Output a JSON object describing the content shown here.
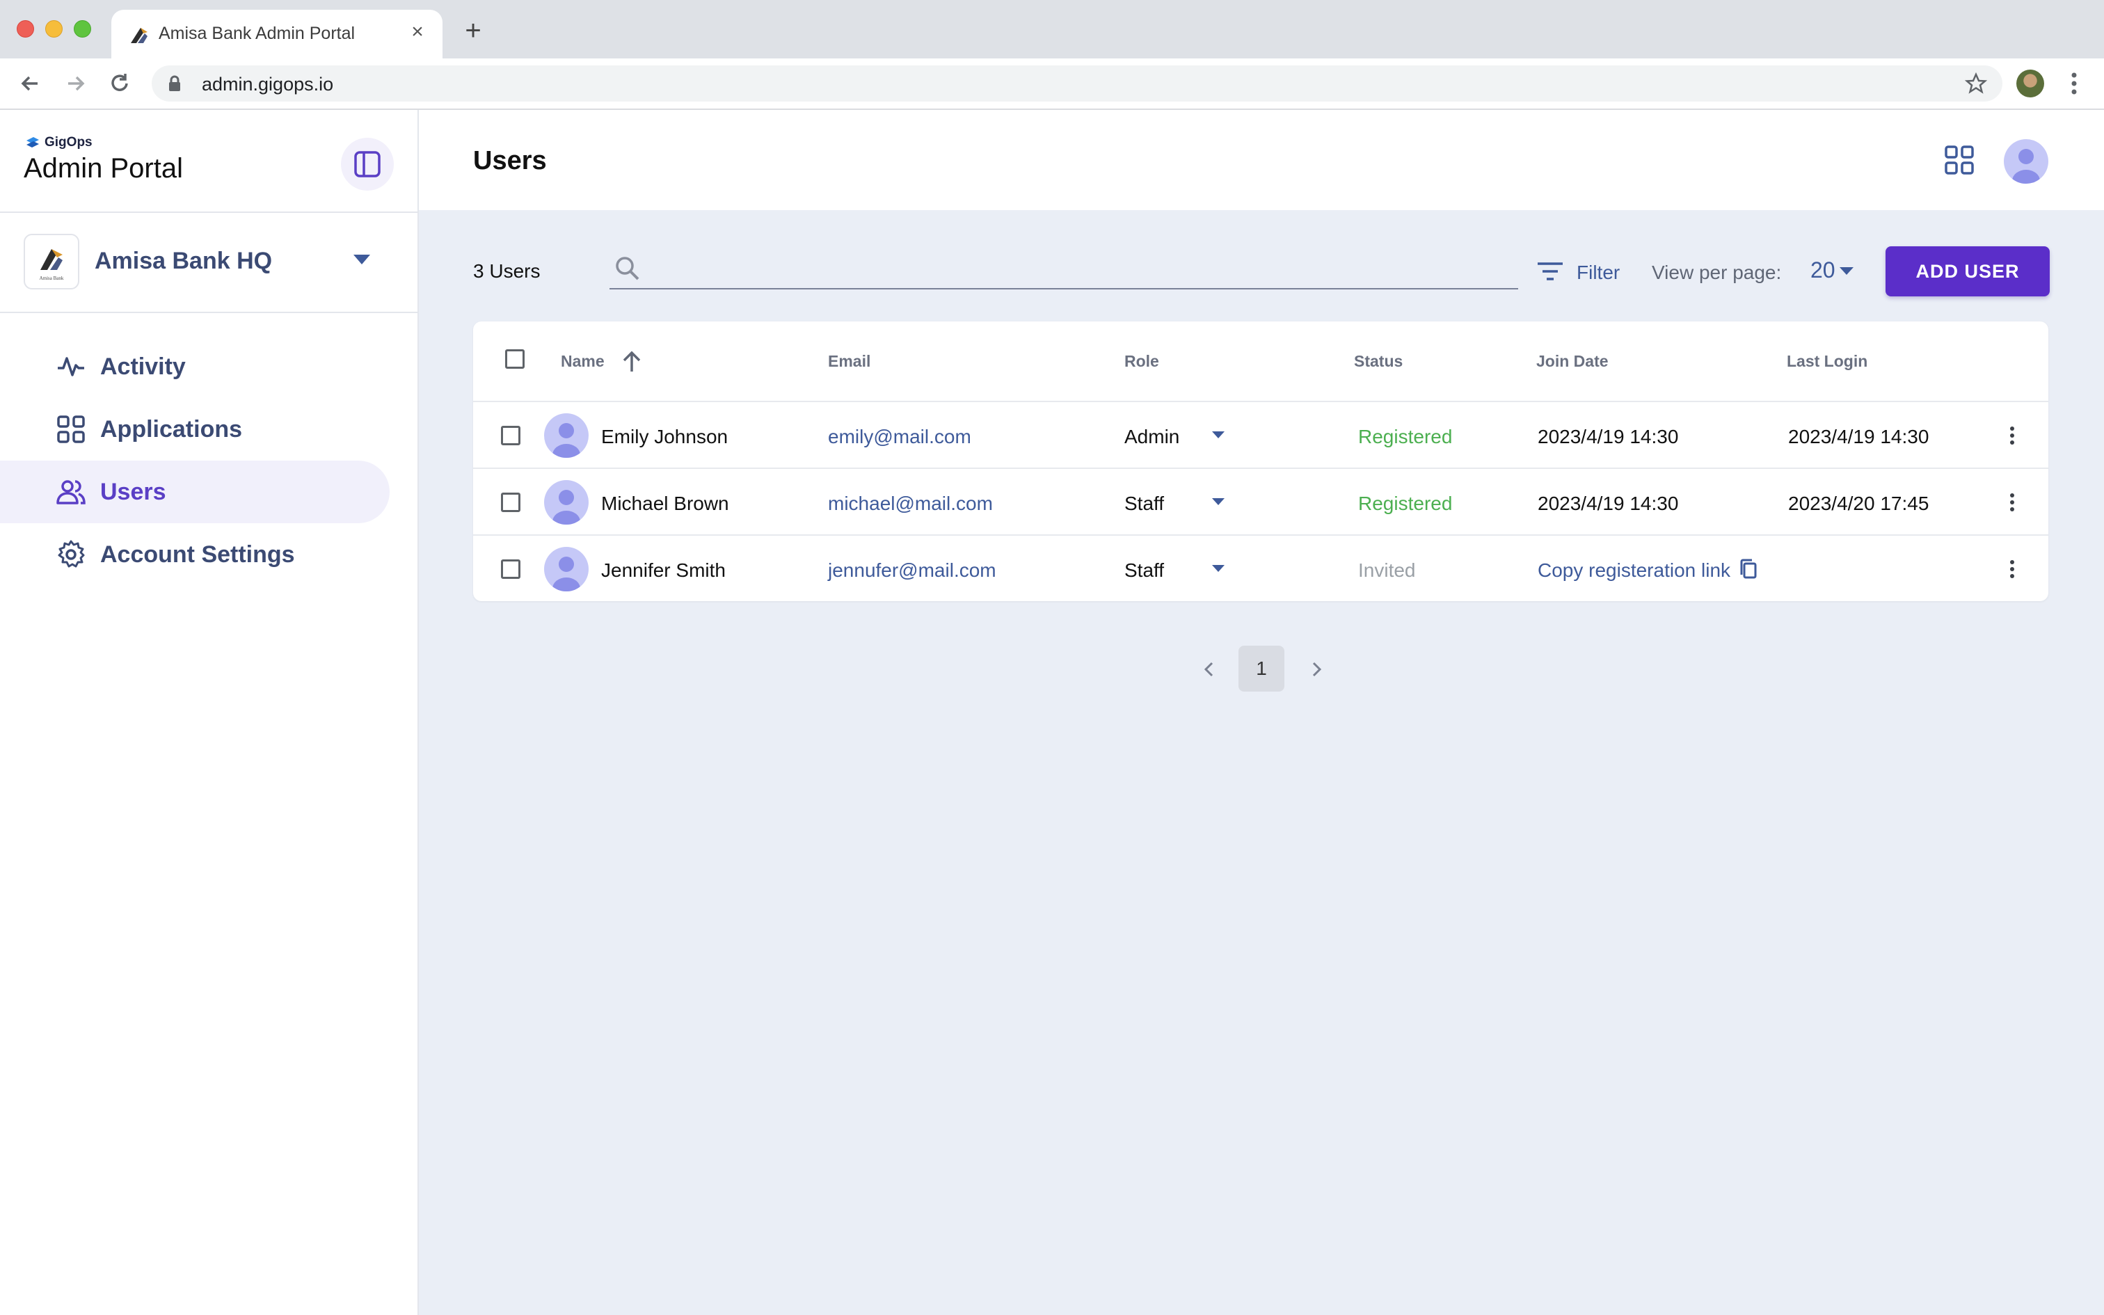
{
  "browser": {
    "tab_title": "Amisa Bank Admin Portal",
    "url": "admin.gigops.io"
  },
  "sidebar": {
    "brand_small": "GigOps",
    "title": "Admin Portal",
    "org": {
      "name": "Amisa Bank HQ",
      "logo_caption": "Amisa Bank"
    },
    "items": [
      {
        "label": "Activity",
        "icon": "activity-icon",
        "active": false
      },
      {
        "label": "Applications",
        "icon": "grid-icon",
        "active": false
      },
      {
        "label": "Users",
        "icon": "users-icon",
        "active": true
      },
      {
        "label": "Account Settings",
        "icon": "gear-icon",
        "active": false
      }
    ]
  },
  "header": {
    "title": "Users"
  },
  "toolbar": {
    "count": "3 Users",
    "search_placeholder": "",
    "filter_label": "Filter",
    "per_page_label": "View per page:",
    "per_page_value": "20",
    "add_user_label": "ADD USER"
  },
  "table": {
    "columns": [
      "Name",
      "Email",
      "Role",
      "Status",
      "Join Date",
      "Last Login"
    ],
    "rows": [
      {
        "name": "Emily Johnson",
        "email": "emily@mail.com",
        "role": "Admin",
        "status": "Registered",
        "join": "2023/4/19 14:30",
        "last": "2023/4/19 14:30"
      },
      {
        "name": "Michael Brown",
        "email": "michael@mail.com",
        "role": "Staff",
        "status": "Registered",
        "join": "2023/4/19 14:30",
        "last": "2023/4/20 17:45"
      },
      {
        "name": "Jennifer Smith",
        "email": "jennufer@mail.com",
        "role": "Staff",
        "status": "Invited",
        "copy_link": "Copy registeration link"
      }
    ]
  },
  "pagination": {
    "current": "1"
  },
  "colors": {
    "accent": "#5b2ec9",
    "link": "#3e5a9a",
    "registered": "#4caf50",
    "invited": "#9aa0a6",
    "background": "#eaeef6"
  }
}
